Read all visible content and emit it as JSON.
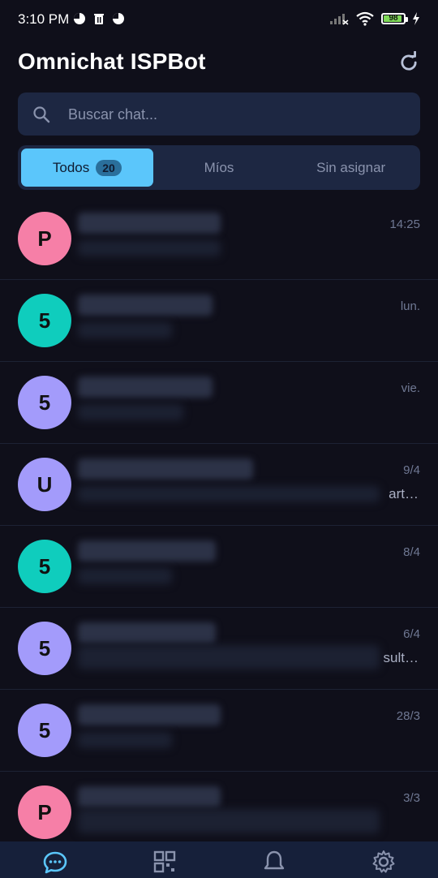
{
  "status_bar": {
    "time": "3:10 PM",
    "battery": "98"
  },
  "header": {
    "title": "Omnichat ISPBot",
    "refresh_icon": "refresh-icon"
  },
  "search": {
    "placeholder": "Buscar chat..."
  },
  "tabs": [
    {
      "label": "Todos",
      "badge": "20",
      "active": true
    },
    {
      "label": "Míos",
      "active": false
    },
    {
      "label": "Sin asignar",
      "active": false
    }
  ],
  "chats": [
    {
      "initial": "P",
      "time": "14:25",
      "tail": ""
    },
    {
      "initial": "5",
      "time": "lun.",
      "tail": ""
    },
    {
      "initial": "5",
      "time": "vie.",
      "tail": ""
    },
    {
      "initial": "U",
      "time": "9/4",
      "tail": "art…"
    },
    {
      "initial": "5",
      "time": "8/4",
      "tail": ""
    },
    {
      "initial": "5",
      "time": "6/4",
      "tail": "sult…"
    },
    {
      "initial": "5",
      "time": "28/3",
      "tail": ""
    },
    {
      "initial": "P",
      "time": "3/3",
      "tail": ""
    }
  ],
  "bottom_nav": [
    {
      "icon": "chat-bubble-icon",
      "active": true
    },
    {
      "icon": "qr-code-icon",
      "active": false
    },
    {
      "icon": "bell-icon",
      "active": false
    },
    {
      "icon": "gear-icon",
      "active": false
    }
  ],
  "colors": {
    "background": "#0f0f1a",
    "accent": "#5bc6fb",
    "surface": "#1d2742",
    "avatar_pink": "#f67fa7",
    "avatar_teal": "#0fcdbd",
    "avatar_violet": "#a39bfb"
  }
}
